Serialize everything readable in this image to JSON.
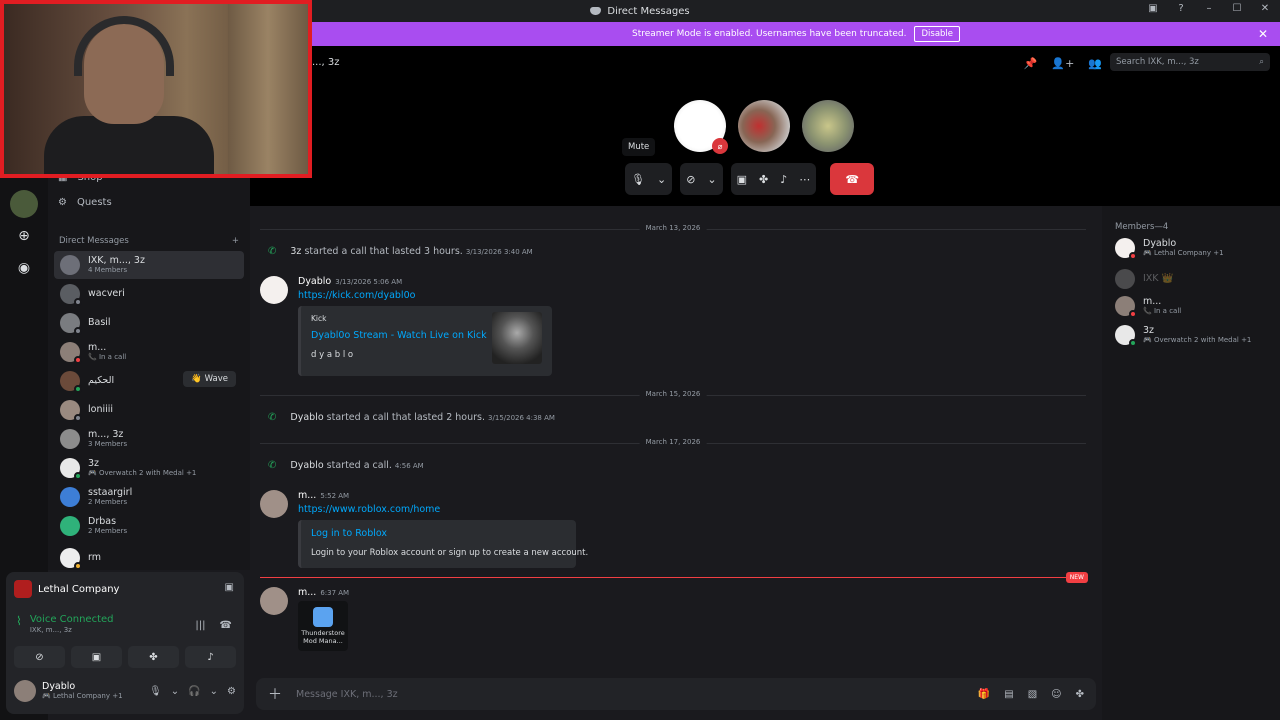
{
  "window": {
    "title": "Direct Messages"
  },
  "banner": {
    "text": "Streamer Mode is enabled. Usernames have been truncated.",
    "button": "Disable"
  },
  "sidebar": {
    "links": [
      {
        "label": "Shop",
        "icon": "shop-icon"
      },
      {
        "label": "Quests",
        "icon": "quests-icon"
      }
    ],
    "dm_header": "Direct Messages",
    "dms": [
      {
        "name": "IXK, m..., 3z",
        "sub": "4 Members",
        "active": true
      },
      {
        "name": "wacveri",
        "sub": ""
      },
      {
        "name": "Basil",
        "sub": ""
      },
      {
        "name": "m...",
        "sub": "In a call"
      },
      {
        "name": "الحكيم",
        "sub": "",
        "wave": "Wave"
      },
      {
        "name": "loniiii",
        "sub": ""
      },
      {
        "name": "m..., 3z",
        "sub": "3 Members"
      },
      {
        "name": "3z",
        "sub": "Overwatch 2 with Medal +1"
      },
      {
        "name": "sstaargirl",
        "sub": "2 Members"
      },
      {
        "name": "Drbas",
        "sub": "2 Members"
      },
      {
        "name": "rm",
        "sub": ""
      }
    ]
  },
  "panel": {
    "activity": "Lethal Company",
    "voice_title": "Voice Connected",
    "voice_sub": "IXK, m..., 3z",
    "user_name": "Dyablo",
    "user_sub": "Lethal Company +1"
  },
  "call": {
    "title": "..., 3z",
    "search_placeholder": "Search IXK, m..., 3z",
    "tooltip": "Mute"
  },
  "chat": {
    "dividers": [
      "March 13, 2026",
      "March 15, 2026",
      "March 17, 2026"
    ],
    "sys1": {
      "user": "3z",
      "text": "started a call that lasted 3 hours.",
      "time": "3/13/2026 3:40 AM"
    },
    "msg1": {
      "user": "Dyablo",
      "time": "3/13/2026 5:06 AM",
      "link": "https://kick.com/dyabl0o",
      "embed_provider": "Kick",
      "embed_title": "Dyabl0o Stream - Watch Live on Kick",
      "embed_desc": "d y a b l o"
    },
    "sys2": {
      "user": "Dyablo",
      "text": "started a call that lasted 2 hours.",
      "time": "3/15/2026 4:38 AM"
    },
    "sys3": {
      "user": "Dyablo",
      "text": "started a call.",
      "time": "4:56 AM"
    },
    "msg2": {
      "user": "m...",
      "time": "5:52 AM",
      "link": "https://www.roblox.com/home",
      "embed_title": "Log in to Roblox",
      "embed_desc": "Login to your Roblox account or sign up to create a new account."
    },
    "new_badge": "NEW",
    "msg3": {
      "user": "m...",
      "time": "6:37 AM",
      "attach_label_1": "Thunderstore",
      "attach_label_2": "Mod Mana..."
    },
    "composer_placeholder": "Message IXK, m..., 3z"
  },
  "members": {
    "header": "Members—4",
    "list": [
      {
        "name": "Dyablo",
        "sub": "Lethal Company +1",
        "status": "#f23f43"
      },
      {
        "name": "IXK 👑",
        "sub": "",
        "status": "#80848e",
        "offline": true
      },
      {
        "name": "m...",
        "sub": "In a call",
        "status": "#f23f43"
      },
      {
        "name": "3z",
        "sub": "Overwatch 2 with Medal +1",
        "status": "#23a55a"
      }
    ]
  }
}
